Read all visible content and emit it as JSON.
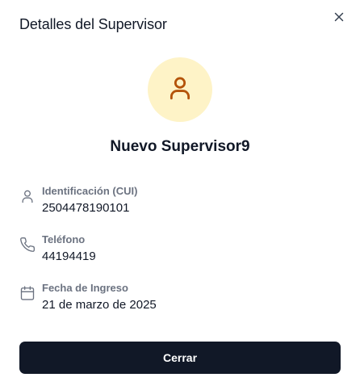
{
  "dialog": {
    "title": "Detalles del Supervisor",
    "close_icon": "close-icon"
  },
  "avatar": {
    "icon": "user-icon",
    "background": "#fef3c7",
    "icon_color": "#b45309"
  },
  "supervisor": {
    "name": "Nuevo Supervisor9"
  },
  "details": [
    {
      "icon": "user-icon",
      "label": "Identificación (CUI)",
      "value": "2504478190101"
    },
    {
      "icon": "phone-icon",
      "label": "Teléfono",
      "value": "44194419"
    },
    {
      "icon": "calendar-icon",
      "label": "Fecha de Ingreso",
      "value": "21 de marzo de 2025"
    }
  ],
  "footer": {
    "close_label": "Cerrar"
  },
  "colors": {
    "primary_button": "#111827",
    "label_text": "#6b7280"
  }
}
